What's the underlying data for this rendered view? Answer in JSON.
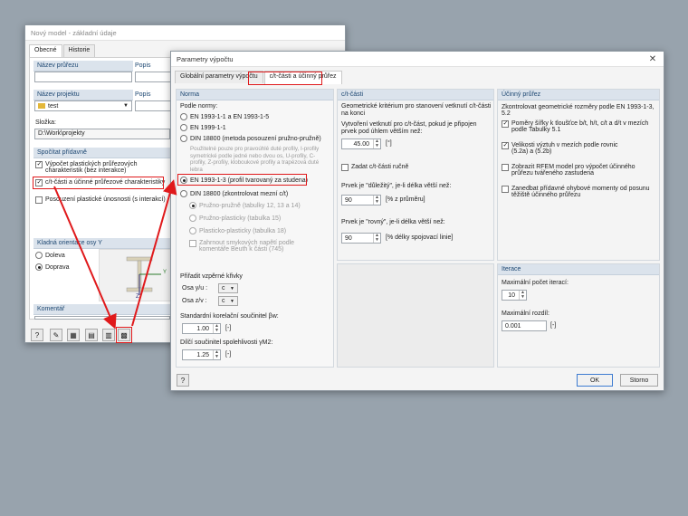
{
  "back_window": {
    "title": "Nový model - základní údaje",
    "tabs": [
      "Obecné",
      "Historie"
    ],
    "fields": {
      "section_name_label": "Název průřezu",
      "desc_label_1": "Popis",
      "project_label": "Název projektu",
      "desc_label_2": "Popis",
      "project_value": "test",
      "folder_label": "Složka:",
      "folder_value": "D:\\Work\\projekty"
    },
    "calc": {
      "header": "Spočítat přídavně",
      "opt1": "Výpočet plastických průřezových charakteristik (bez interakce)",
      "opt2": "c/t-části a účinné průřezové charakteristiky",
      "opt3": "Posouzení plastické únosnosti (s interakcí)"
    },
    "orient": {
      "header": "Kladná orientace osy Y",
      "left": "Doleva",
      "right": "Doprava",
      "y_axis": "Y",
      "z_axis": "Z"
    },
    "comment_header": "Komentář"
  },
  "front_window": {
    "title": "Parametry výpočtu",
    "close": "✕",
    "tabs": [
      "Globální parametry výpočtu",
      "c/t-části a účinný průřez"
    ],
    "norma": {
      "header": "Norma",
      "by_norm": "Podle normy:",
      "opt1": "EN 1993-1-1 a EN 1993-1-5",
      "opt2": "EN 1999-1-1",
      "opt3": "DIN 18800 (metoda posouzení pružno-pružně)",
      "note": "Použitelné pouze pro pravoúhlé duté profily, I-profily symetrické podle jedné nebo dvou os, U-profily, C-profily, Z-profily, kloboukové profily a trapézová duté lebra",
      "opt4": "EN 1993-1-3 (profil tvarovaný za studena)",
      "opt5": "DIN 18800 (zkontrolovat mezní c/t)",
      "sub1": "Pružno-pružně (tabulky 12, 13 a 14)",
      "sub2": "Pružno-plasticky (tabulka 15)",
      "sub3": "Plasticko-plasticky (tabulka 18)",
      "sub_chk": "Zahrnout smykových napětí podle komentáře Beuth k části (745)",
      "buckling": "Přiřadit vzpěrné křivky",
      "axis_y": "Osa y/u :",
      "axis_z": "Osa z/v :",
      "curve_y": "c",
      "curve_z": "c",
      "corr_label": "Standardní korelační součinitel βw:",
      "corr_value": "1.00",
      "corr_unit": "[-]",
      "rel_label": "Dílčí součinitel spolehlivosti γM2:",
      "rel_value": "1.25",
      "rel_unit": "[-]"
    },
    "ct": {
      "header": "c/t-části",
      "geom": "Geometrické kritérium pro stanovení vetknutí c/t-části na konci",
      "create": "Vytvoření vetknutí pro c/t-část, pokud je připojen prvek pod úhlem větším než:",
      "angle": "45.00",
      "angle_unit": "[°]",
      "manual": "Zadat c/t-části ručně",
      "important": "Prvek je \"důležitý\", je-li délka větší než:",
      "important_val": "90",
      "important_unit": "[% z průměru]",
      "flat": "Prvek je \"rovný\", je-li délka větší než:",
      "flat_val": "90",
      "flat_unit": "[% délky spojovací linie]"
    },
    "eff": {
      "header": "Účinný průřez",
      "check_geom": "Zkontrolovat geometrické rozměry podle EN 1993-1-3, 5.2",
      "chk1": "Poměry šířky k tloušťce b/t, h/t, c/t a d/t v mezích podle Tabulky 5.1",
      "chk2": "Velikosti výztuh v mezích podle rovnic (5.2a) a (5.2b)",
      "chk3": "Zobrazit RFEM model pro výpočet účinného průřezu tvářeného zastudena",
      "chk4": "Zanedbat přídavné ohybové momenty od posunu těžiště účinného průřezu"
    },
    "iter": {
      "header": "Iterace",
      "max_label": "Maximální počet iterací:",
      "max_val": "10",
      "diff_label": "Maximální rozdíl:",
      "diff_val": "0.001",
      "diff_unit": "[-]"
    },
    "buttons": {
      "ok": "OK",
      "cancel": "Storno"
    }
  },
  "colors": {
    "highlight": "#e0191b",
    "section_bg": "#dbe3ec",
    "section_text": "#204a74"
  }
}
